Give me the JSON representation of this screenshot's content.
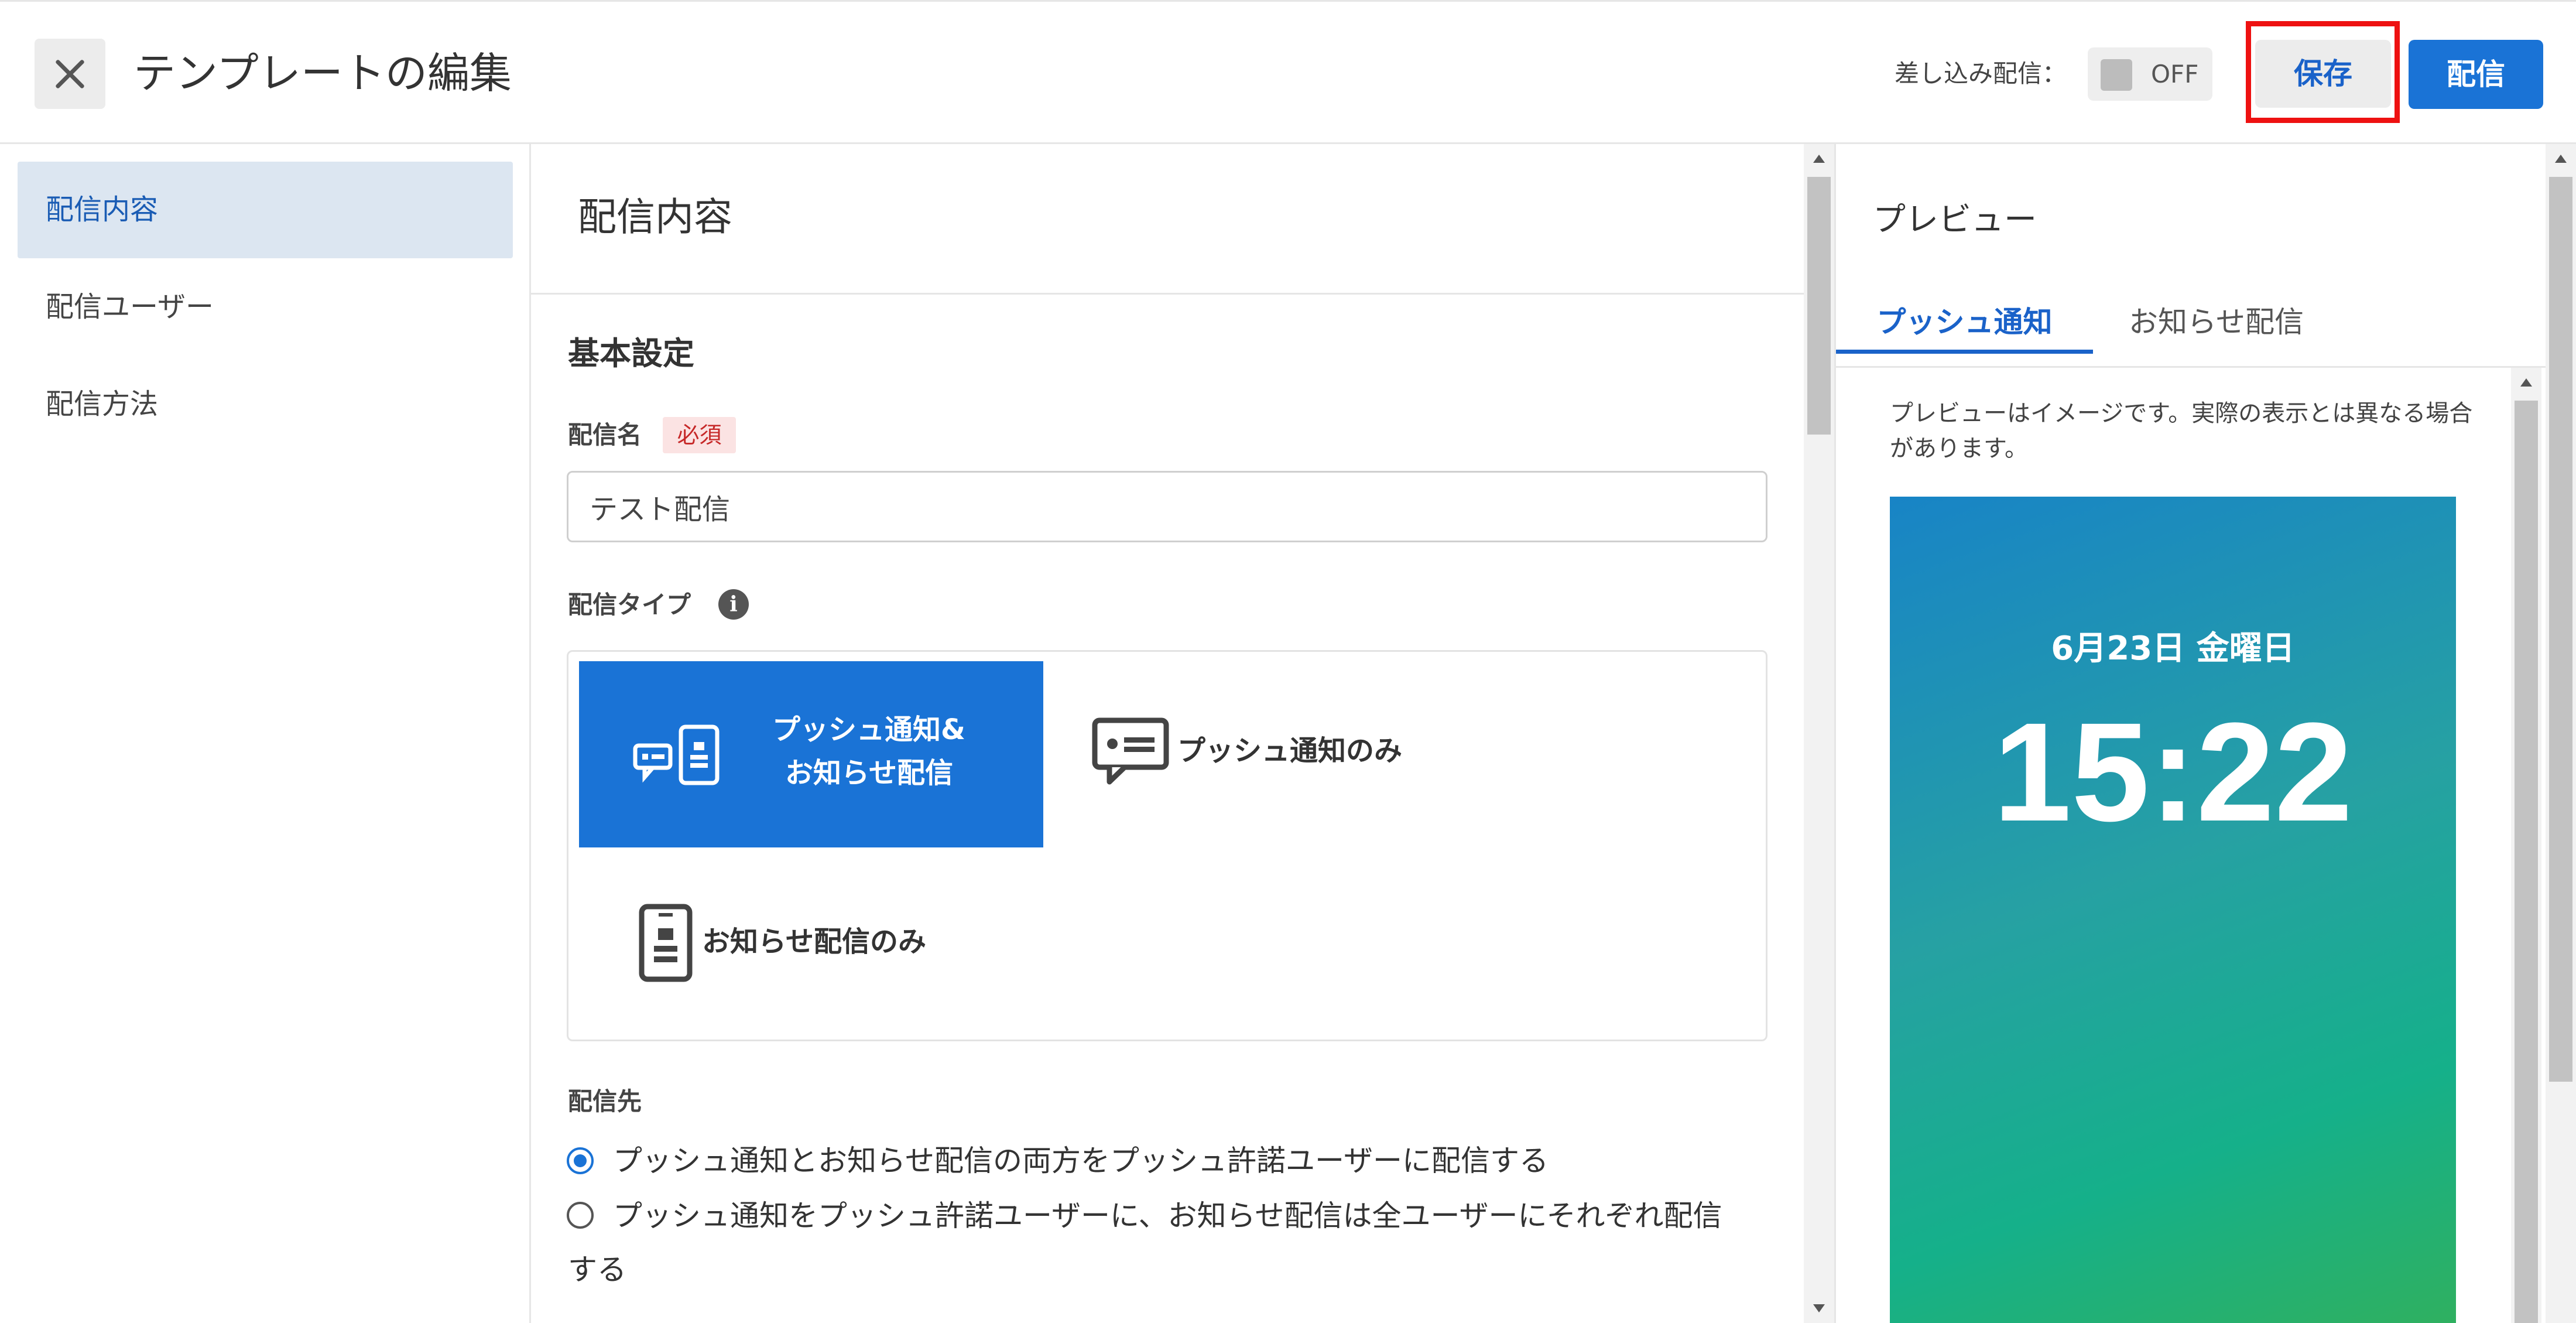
{
  "header": {
    "title": "テンプレートの編集",
    "merge_label": "差し込み配信：",
    "merge_toggle": "OFF",
    "save_label": "保存",
    "send_label": "配信"
  },
  "nav": {
    "items": [
      {
        "label": "配信内容",
        "active": true
      },
      {
        "label": "配信ユーザー",
        "active": false
      },
      {
        "label": "配信方法",
        "active": false
      }
    ]
  },
  "main": {
    "section_title": "配信内容",
    "basic_settings": "基本設定",
    "name_label": "配信名",
    "required_badge": "必須",
    "name_value": "テスト配信",
    "type_label": "配信タイプ",
    "type_options": [
      {
        "label_line1": "プッシュ通知&",
        "label_line2": "お知らせ配信",
        "selected": true
      },
      {
        "label": "プッシュ通知のみ",
        "selected": false
      },
      {
        "label": "お知らせ配信のみ",
        "selected": false
      }
    ],
    "destination_label": "配信先",
    "destination_options": [
      {
        "label": "プッシュ通知とお知らせ配信の両方をプッシュ許諾ユーザーに配信する",
        "checked": true
      },
      {
        "label": "プッシュ通知をプッシュ許諾ユーザーに、お知らせ配信は全ユーザーにそれぞれ配信する",
        "checked": false
      }
    ]
  },
  "preview": {
    "title": "プレビュー",
    "tabs": [
      {
        "label": "プッシュ通知",
        "active": true
      },
      {
        "label": "お知らせ配信",
        "active": false
      }
    ],
    "note": "プレビューはイメージです。実際の表示とは異なる場合があります。",
    "phone_date": "6月23日 金曜日",
    "phone_time": "15:22"
  },
  "colors": {
    "accent": "#1a73d6",
    "highlight_border": "#ee1111",
    "nav_active_bg": "#dce6f1",
    "required_bg": "#fbe3e3",
    "required_text": "#c62828"
  }
}
